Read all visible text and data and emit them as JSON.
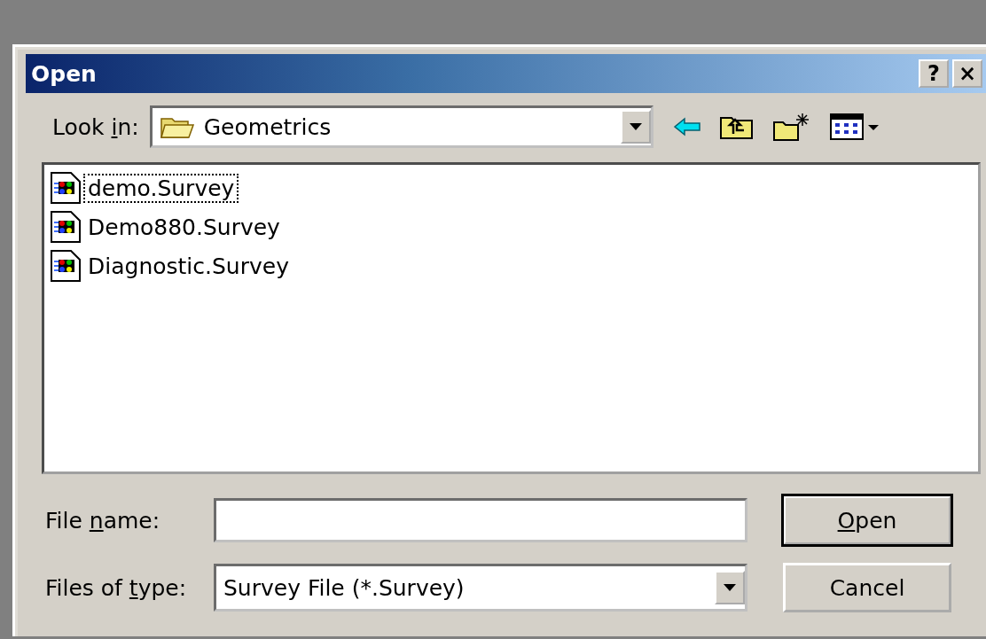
{
  "window": {
    "title": "Open",
    "title_buttons": [
      "?",
      "×"
    ]
  },
  "look_in": {
    "label": {
      "before": "Look ",
      "key": "i",
      "after": "n:"
    },
    "value": "Geometrics"
  },
  "files": [
    {
      "name": "demo.Survey",
      "focused": true
    },
    {
      "name": "Demo880.Survey",
      "focused": false
    },
    {
      "name": "Diagnostic.Survey",
      "focused": false
    }
  ],
  "file_name": {
    "label": {
      "before": "File ",
      "key": "n",
      "after": "ame:"
    }
  },
  "file_type": {
    "label": {
      "before": "Files of ",
      "key": "t",
      "after": "ype:"
    },
    "value": "Survey File (*.Survey)"
  },
  "buttons": [
    {
      "label": {
        "key": "O",
        "after": "pen"
      },
      "default": true
    },
    {
      "label": {
        "before": "Cancel"
      },
      "default": false
    }
  ]
}
